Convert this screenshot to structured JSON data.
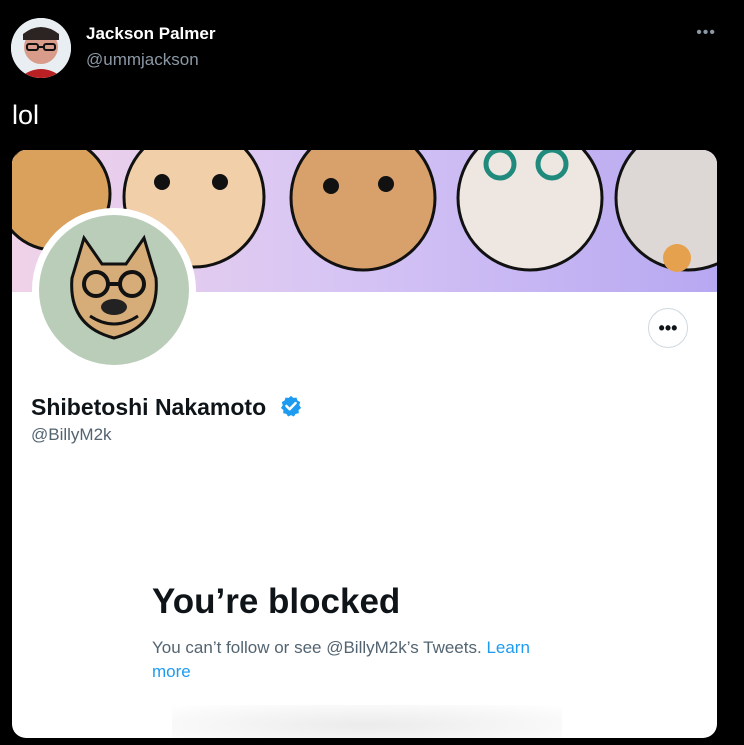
{
  "tweet": {
    "author_name": "Jackson Palmer",
    "author_handle": "@ummjackson",
    "more_icon": "more-horizontal-icon",
    "text": "lol"
  },
  "profile_card": {
    "display_name": "Shibetoshi Nakamoto",
    "handle": "@BillyM2k",
    "verified_icon": "verified-badge-icon",
    "more_icon": "more-horizontal-icon",
    "blocked_title": "You’re blocked",
    "blocked_message": "You can’t follow or see @BillyM2k’s Tweets. ",
    "learn_more_label": "Learn more"
  },
  "colors": {
    "background": "#000000",
    "accent": "#1d9bf0",
    "text_primary": "#0f1419",
    "text_secondary": "#536471"
  }
}
